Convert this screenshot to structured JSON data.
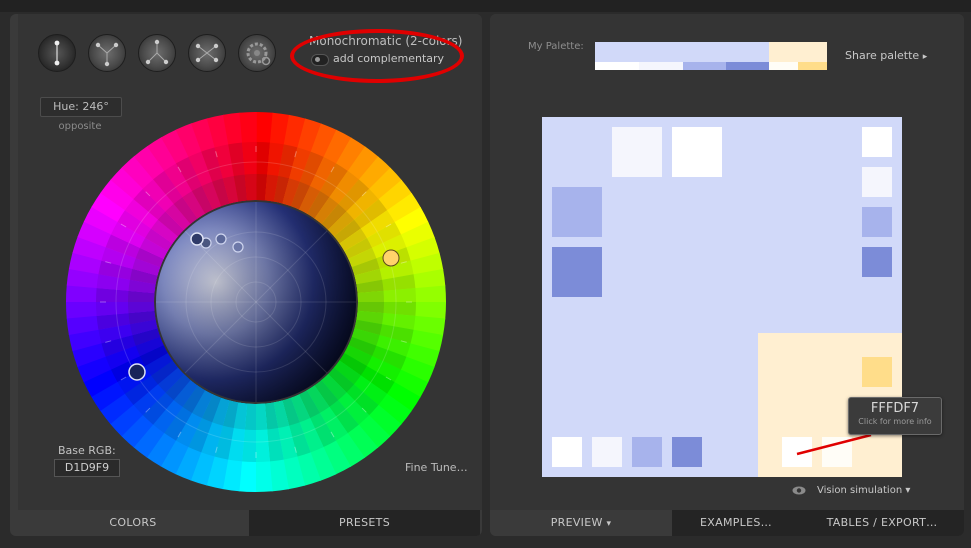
{
  "left_panel": {
    "scheme_name": "Monochromatic (2-colors)",
    "add_complementary": "add complementary",
    "hue_label": "Hue: 246°",
    "opposite": "opposite",
    "base_rgb_label": "Base RGB:",
    "base_rgb_value": "D1D9F9",
    "fine_tune": "Fine Tune…",
    "tabs": [
      "COLORS",
      "PRESETS"
    ],
    "modes": [
      "mono-dial-icon",
      "triad-dial-icon",
      "tetrad-dial-icon",
      "analogic-dial-icon",
      "gear-dial-icon"
    ]
  },
  "right_panel": {
    "my_palette": "My Palette:",
    "share": "Share palette",
    "share_arrow": "▸",
    "tabs": [
      {
        "label": "PREVIEW",
        "arrow": "▾"
      },
      {
        "label": "EXAMPLES…"
      },
      {
        "label": "TABLES / EXPORT…"
      }
    ],
    "vision": "Vision simulation",
    "vision_arrow": "▾",
    "tooltip_hex": "FFFDF7",
    "tooltip_hint": "Click for more info"
  },
  "colors": {
    "base": "#D1D9F9",
    "base_light": "#F5F6FD",
    "base_white": "#FFFFFF",
    "base_mid": "#A7B3EC",
    "base_dark": "#7C8CD8",
    "comp": "#FFEFD1",
    "comp_light": "#FFFDF7",
    "comp_mid": "#FFDD8A",
    "accent": "#e00000",
    "marker_comp": "#FFD36A",
    "marker_base": "#17235a"
  }
}
